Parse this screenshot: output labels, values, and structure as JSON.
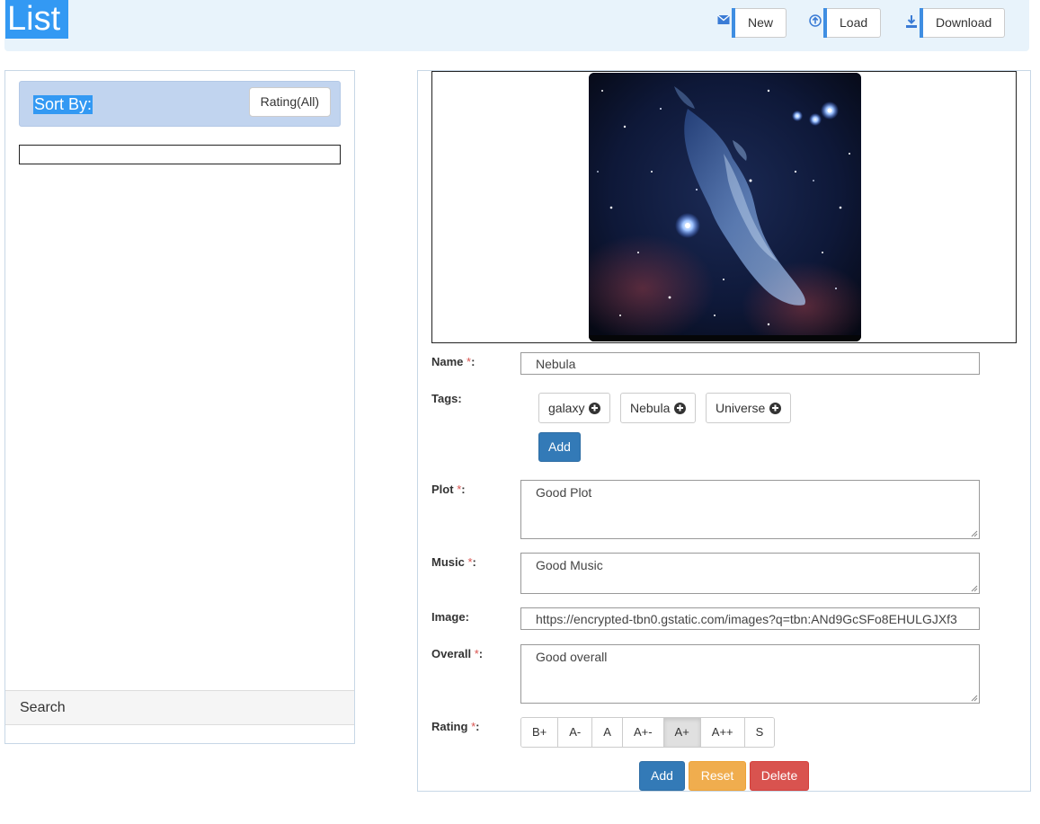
{
  "header": {
    "title": "List",
    "buttons": [
      {
        "label": "New",
        "icon": "envelope-icon"
      },
      {
        "label": "Load",
        "icon": "upload-circle-icon"
      },
      {
        "label": "Download",
        "icon": "download-icon"
      }
    ]
  },
  "sidebar": {
    "sort_label": "Sort By:",
    "sort_button": "Rating(All)",
    "search_label": "Search"
  },
  "form": {
    "labels": {
      "name": "Name",
      "tags": "Tags:",
      "plot": "Plot",
      "music": "Music",
      "image": "Image:",
      "overall": "Overall",
      "rating": "Rating",
      "required_marker": "*",
      "colon": ":"
    },
    "name_value": "Nebula",
    "tags": [
      "galaxy",
      "Nebula",
      "Universe"
    ],
    "add_tag_label": "Add",
    "plot_value": "Good Plot",
    "music_value": "Good Music",
    "image_value": "https://encrypted-tbn0.gstatic.com/images?q=tbn:ANd9GcSFo8EHULGJXf3",
    "overall_value": "Good overall",
    "rating_options": [
      "B+",
      "A-",
      "A",
      "A+-",
      "A+",
      "A++",
      "S"
    ],
    "rating_selected": "A+",
    "actions": {
      "add": "Add",
      "reset": "Reset",
      "delete": "Delete"
    }
  },
  "colors": {
    "accent": "#3399f3",
    "primary": "#337ab7",
    "warning": "#f0ad4e",
    "danger": "#d9534f",
    "header_bg": "#e8f3fb"
  }
}
